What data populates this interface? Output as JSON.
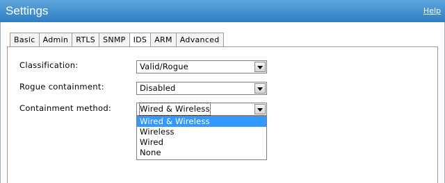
{
  "window": {
    "title": "Settings",
    "help_link": "Help"
  },
  "tabs": [
    {
      "label": "Basic",
      "active": false
    },
    {
      "label": "Admin",
      "active": false
    },
    {
      "label": "RTLS",
      "active": false
    },
    {
      "label": "SNMP",
      "active": false
    },
    {
      "label": "IDS",
      "active": true
    },
    {
      "label": "ARM",
      "active": false
    },
    {
      "label": "Advanced",
      "active": false
    }
  ],
  "form": {
    "classification": {
      "label": "Classification:",
      "value": "Valid/Rogue"
    },
    "rogue_containment": {
      "label": "Rogue containment:",
      "value": "Disabled"
    },
    "containment_method": {
      "label": "Containment method:",
      "value": "Wired & Wireless",
      "options": [
        "Wired & Wireless",
        "Wireless",
        "Wired",
        "None"
      ],
      "highlighted_option": "Wired & Wireless"
    }
  },
  "colors": {
    "title_bar": "#3f8fd2",
    "selected_option": "#3399ff"
  }
}
